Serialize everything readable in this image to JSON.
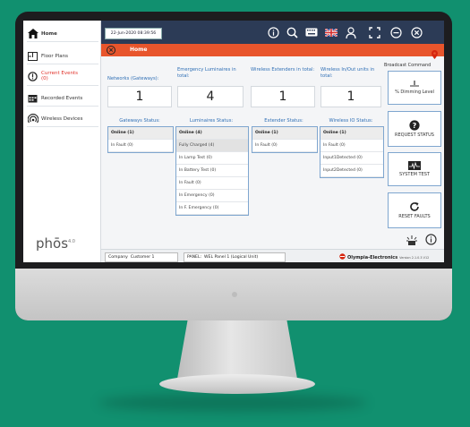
{
  "sidebar": {
    "items": [
      {
        "label": "Home",
        "icon": "home-icon"
      },
      {
        "label": "Floor Plans",
        "icon": "floor-plan-icon"
      },
      {
        "label": "Current Events",
        "count": "(0)",
        "icon": "alert-circle-icon"
      },
      {
        "label": "Recorded Events",
        "icon": "calendar-icon"
      },
      {
        "label": "Wireless Devices",
        "icon": "wireless-icon"
      }
    ],
    "logo": "phōs",
    "logo_version": "4.0"
  },
  "topbar": {
    "datetime": "22-Jun-2020 08:39:56",
    "icons": [
      "info-icon",
      "search-icon",
      "keyboard-icon",
      "uk-flag-icon",
      "user-icon",
      "fullscreen-icon",
      "minus-icon",
      "close-icon"
    ]
  },
  "homebar": {
    "title": "Home"
  },
  "stats": [
    {
      "label": "Networks (Gateways):",
      "value": "1"
    },
    {
      "label": "Emergency Luminaires in total:",
      "value": "4"
    },
    {
      "label": "Wireless Extenders in total:",
      "value": "1"
    },
    {
      "label": "Wireless In/Out units in total:",
      "value": "1"
    }
  ],
  "statuses": {
    "gateways": {
      "title": "Gateways Status:",
      "rows": [
        "Online  (1)",
        "In Fault  (0)"
      ]
    },
    "luminaires": {
      "title": "Luminaires Status:",
      "rows": [
        "Online  (4)",
        "Fully Charged  (4)",
        "In Lamp Test  (0)",
        "In Battery Test  (0)",
        "In Fault  (0)",
        "In Emergency  (0)",
        "In F. Emergency  (0)"
      ]
    },
    "extender": {
      "title": "Extender Status:",
      "rows": [
        "Online  (1)",
        "In Fault  (0)"
      ]
    },
    "wireless_io": {
      "title": "Wireless IO Status:",
      "rows": [
        "Online  (1)",
        "In Fault  (0)",
        "Input1Detected  (0)",
        "Input2Detected  (0)"
      ]
    }
  },
  "broadcast": {
    "title": "Broadcast Command",
    "buttons": [
      {
        "label": "% Dimming Level"
      },
      {
        "label": "REQUEST STATUS"
      },
      {
        "label": "SYSTEM TEST"
      },
      {
        "label": "RESET FAULTS"
      }
    ]
  },
  "bottom": {
    "company_label": "Company",
    "company_value": "Customer 1",
    "panel_label": "PANEL:",
    "panel_value": "WEL Panel 1 (Logical Unit)",
    "brand": "Olympia-Electronics",
    "version": "Version 2.1.0.3 V12"
  },
  "colors": {
    "topbar": "#2c3b56",
    "accent": "#e8552c",
    "link": "#2f6fb5",
    "background": "#11906f"
  }
}
